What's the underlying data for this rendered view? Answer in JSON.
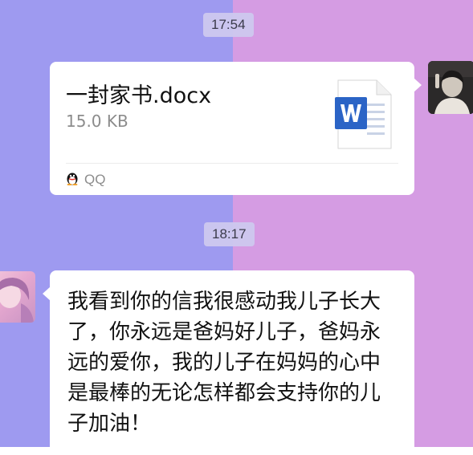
{
  "timestamps": [
    "17:54",
    "18:17"
  ],
  "file_message": {
    "file_name": "一封家书.docx",
    "file_size": "15.0 KB",
    "file_icon": "word-document-icon",
    "source_icon": "qq-penguin-icon",
    "source_label": "QQ",
    "colors": {
      "word_blue": "#2b64c6"
    }
  },
  "text_message": {
    "lines": [
      "我看到你的信我很感动我儿子长大",
      "了，你永远是爸妈好儿子，爸妈永",
      "远的爱你，我的儿子在妈妈的心中",
      "是最棒的无论怎样都会支持你的儿",
      "子加油！"
    ]
  },
  "colors": {
    "background_left": "#9e9af0",
    "background_right": "#d59ce3",
    "bubble": "#ffffff"
  }
}
